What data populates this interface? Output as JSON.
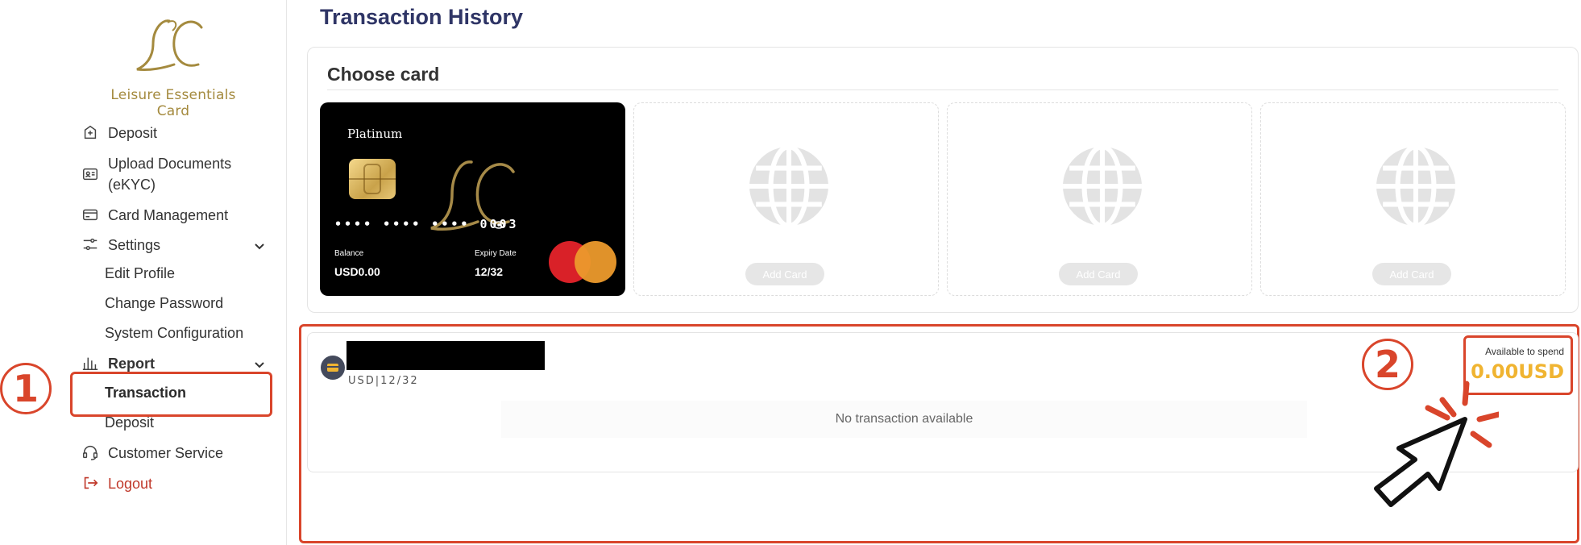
{
  "brand": {
    "name": "Leisure Essentials Card",
    "accent": "#a48a3e"
  },
  "sidebar": {
    "items": [
      {
        "label": "Deposit",
        "icon": "deposit-icon"
      },
      {
        "label": "Upload Documents (eKYC)",
        "icon": "id-card-icon"
      },
      {
        "label": "Card Management",
        "icon": "card-icon"
      },
      {
        "label": "Settings",
        "icon": "sliders-icon"
      },
      {
        "label": "Report",
        "icon": "bar-chart-icon"
      },
      {
        "label": "Customer Service",
        "icon": "headset-icon"
      },
      {
        "label": "Logout",
        "icon": "logout-icon"
      }
    ],
    "settings_sub": [
      "Edit Profile",
      "Change Password",
      "System Configuration"
    ],
    "report_sub": [
      "Transaction",
      "Deposit"
    ],
    "active_sub": "Transaction"
  },
  "main": {
    "title": "Transaction History",
    "choose_card_title": "Choose card",
    "card": {
      "tier": "Platinum",
      "masked_number": "•••• •••• •••• 0003",
      "balance_label": "Balance",
      "balance_value": "USD0.00",
      "expiry_label": "Expiry Date",
      "expiry_value": "12/32",
      "network": "mastercard"
    },
    "empty_slots": [
      {
        "label": "Add Card"
      },
      {
        "label": "Add Card"
      },
      {
        "label": "Add Card"
      }
    ],
    "transactions": {
      "card_meta": "USD|12/32",
      "empty_text": "No transaction available",
      "spend_label": "Available to spend",
      "spend_value": "0.00USD"
    }
  },
  "annotations": {
    "step1": "1",
    "step2": "2",
    "color": "#d9452b"
  }
}
